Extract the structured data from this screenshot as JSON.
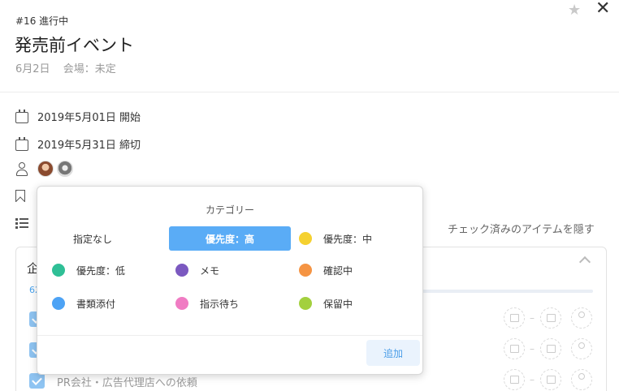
{
  "header": {
    "task_id": "#16 進行中",
    "title": "発売前イベント",
    "date": "6月2日",
    "venue": "会場：未定"
  },
  "icons": {
    "star": "★",
    "close": "✕"
  },
  "details": {
    "start": "2019年5月01日 開始",
    "due": "2019年5月31日 締切"
  },
  "checklist": {
    "hide_checked": "チェック済みのアイテムを隠す",
    "title_fragment": "企",
    "progress_text": "62",
    "items": [
      "PR会社・広告代理店への依頼"
    ],
    "range_dash": "–"
  },
  "popup": {
    "title": "カテゴリー",
    "add_label": "追加",
    "categories": [
      {
        "label": "指定なし",
        "color": ""
      },
      {
        "label": "優先度：高",
        "color": "#5aacf6"
      },
      {
        "label": "優先度：中",
        "color": "#f5d130"
      },
      {
        "label": "優先度：低",
        "color": "#2fbf96"
      },
      {
        "label": "メモ",
        "color": "#7b59c0"
      },
      {
        "label": "確認中",
        "color": "#f59443"
      },
      {
        "label": "書類添付",
        "color": "#4da3f5"
      },
      {
        "label": "指示待ち",
        "color": "#f07cc3"
      },
      {
        "label": "保留中",
        "color": "#a3d03e"
      }
    ],
    "selected": "優先度：高"
  }
}
